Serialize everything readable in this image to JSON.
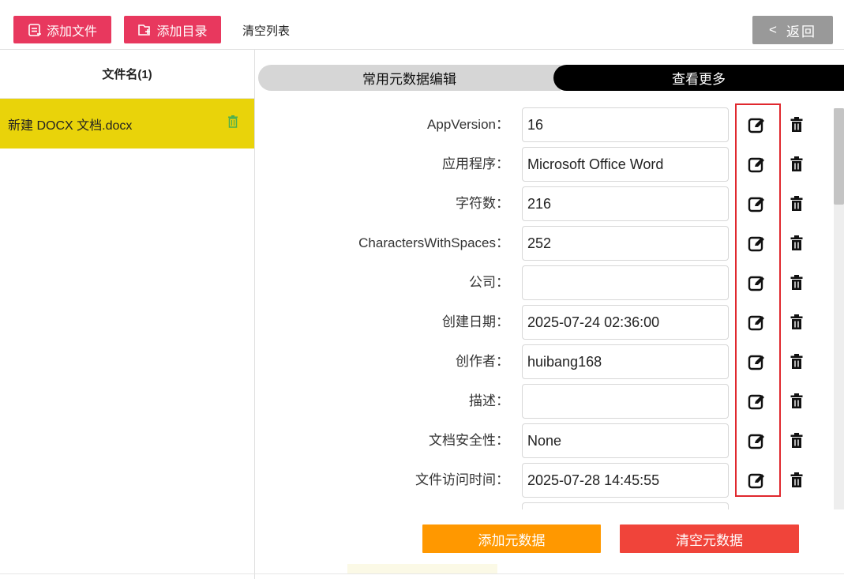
{
  "toolbar": {
    "add_file_label": "添加文件",
    "add_dir_label": "添加目录",
    "clear_list_label": "清空列表",
    "back_label": "返回",
    "back_chevron": "<",
    "accent_color": "#e8385e"
  },
  "file_list": {
    "header": "文件名(1)",
    "items": [
      {
        "name": "新建 DOCX 文档.docx",
        "icon": "trash-icon",
        "selected": true
      }
    ],
    "selected_color": "#e9d30a"
  },
  "tabs": {
    "common": "常用元数据编辑",
    "more": "查看更多"
  },
  "metadata_rows": [
    {
      "label": "AppVersion：",
      "value": "16"
    },
    {
      "label": "应用程序：",
      "value": "Microsoft Office Word"
    },
    {
      "label": "字符数：",
      "value": "216"
    },
    {
      "label": "CharactersWithSpaces：",
      "value": "252"
    },
    {
      "label": "公司：",
      "value": ""
    },
    {
      "label": "创建日期：",
      "value": "2025-07-24 02:36:00"
    },
    {
      "label": "创作者：",
      "value": "huibang168"
    },
    {
      "label": "描述：",
      "value": ""
    },
    {
      "label": "文档安全性：",
      "value": "None"
    },
    {
      "label": "文件访问时间：",
      "value": "2025-07-28 14:45:55"
    },
    {
      "label": "",
      "value": ""
    }
  ],
  "row_icons": {
    "edit": "edit-icon",
    "delete": "trash-icon"
  },
  "actions": {
    "add_metadata": "添加元数据",
    "clear_metadata": "清空元数据",
    "add_color": "#ff9800",
    "clear_color": "#f0443a"
  }
}
